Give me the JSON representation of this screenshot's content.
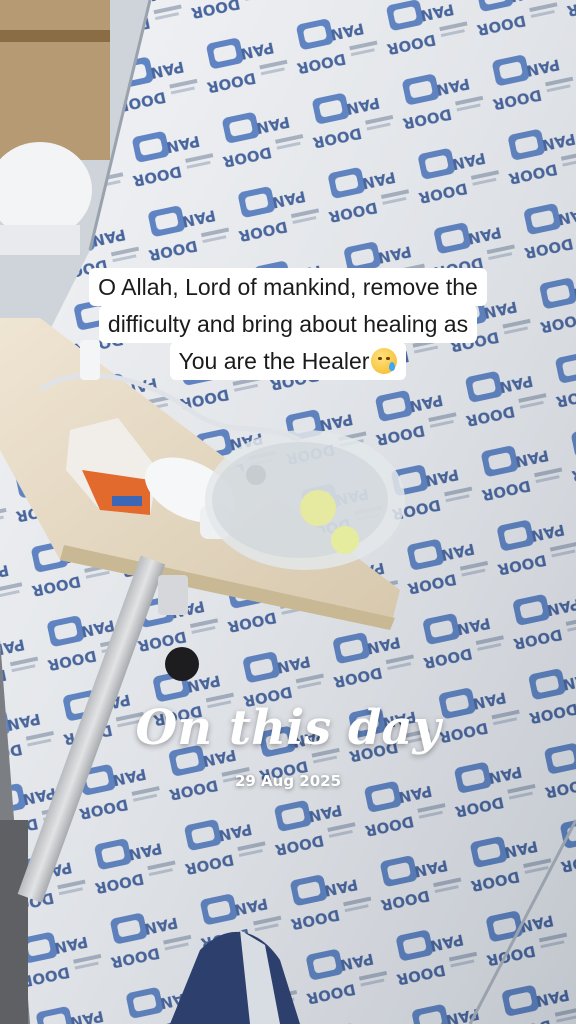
{
  "caption": {
    "lines": [
      "O Allah, Lord of mankind, remove the",
      "difficulty and bring about healing as",
      "You are the Healer"
    ],
    "emoji": "crying-face-emoji"
  },
  "overlay": {
    "title": "On this day",
    "date": "29 Aug 2025"
  },
  "scene": {
    "wall_brand_text": "DOOR PAN",
    "colors": {
      "wall": "#eef0f3",
      "brand_blue": "#2f5fb5",
      "table_top": "#e8dcc6",
      "pole": "#c7c9cc"
    }
  }
}
